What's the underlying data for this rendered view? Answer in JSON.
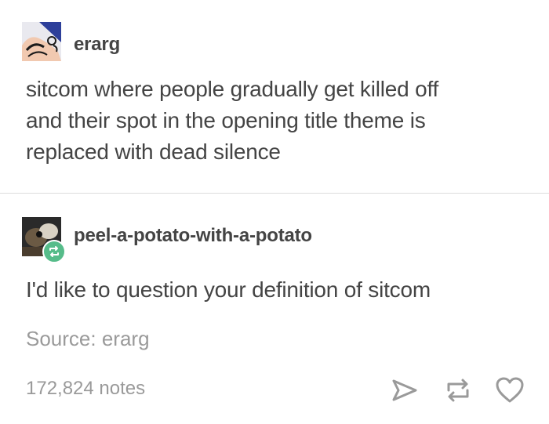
{
  "post": {
    "username": "erarg",
    "text_lines": [
      "sitcom where people gradually get killed off",
      "and their spot in the opening title theme is",
      "replaced with dead silence"
    ]
  },
  "reply": {
    "username": "peel-a-potato-with-a-potato",
    "text": "I'd like to question your definition of sitcom"
  },
  "footer": {
    "source": "Source: erarg",
    "notes": "172,824 notes"
  },
  "icons": {
    "share": "share-icon",
    "reblog": "reblog-icon",
    "like": "heart-icon"
  },
  "colors": {
    "text": "#444444",
    "muted": "#9a9a9a",
    "reblog_badge": "#56bc8a",
    "divider": "#dddddd"
  }
}
